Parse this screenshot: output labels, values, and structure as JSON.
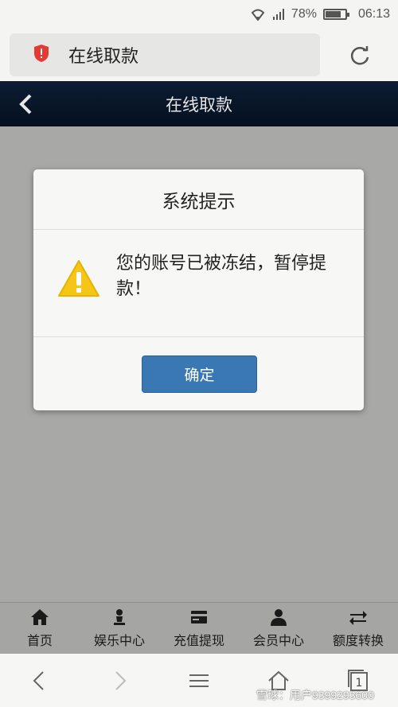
{
  "status_bar": {
    "battery": "78%",
    "time": "06:13"
  },
  "browser": {
    "address_title": "在线取款"
  },
  "header": {
    "title": "在线取款"
  },
  "dialog": {
    "title": "系统提示",
    "message": "您的账号已被冻结，暂停提款！",
    "confirm_label": "确定"
  },
  "bottom_nav": [
    {
      "label": "首页",
      "icon": "home-icon"
    },
    {
      "label": "娱乐中心",
      "icon": "chess-piece-icon"
    },
    {
      "label": "充值提现",
      "icon": "card-icon"
    },
    {
      "label": "会员中心",
      "icon": "user-icon"
    },
    {
      "label": "额度转换",
      "icon": "transfer-icon"
    }
  ],
  "watermark": "雪球：用户9399293600",
  "colors": {
    "header_bg": "#0a1a2e",
    "confirm_bg": "#3a78b4",
    "warning": "#f5c518",
    "security_red": "#e53935"
  }
}
